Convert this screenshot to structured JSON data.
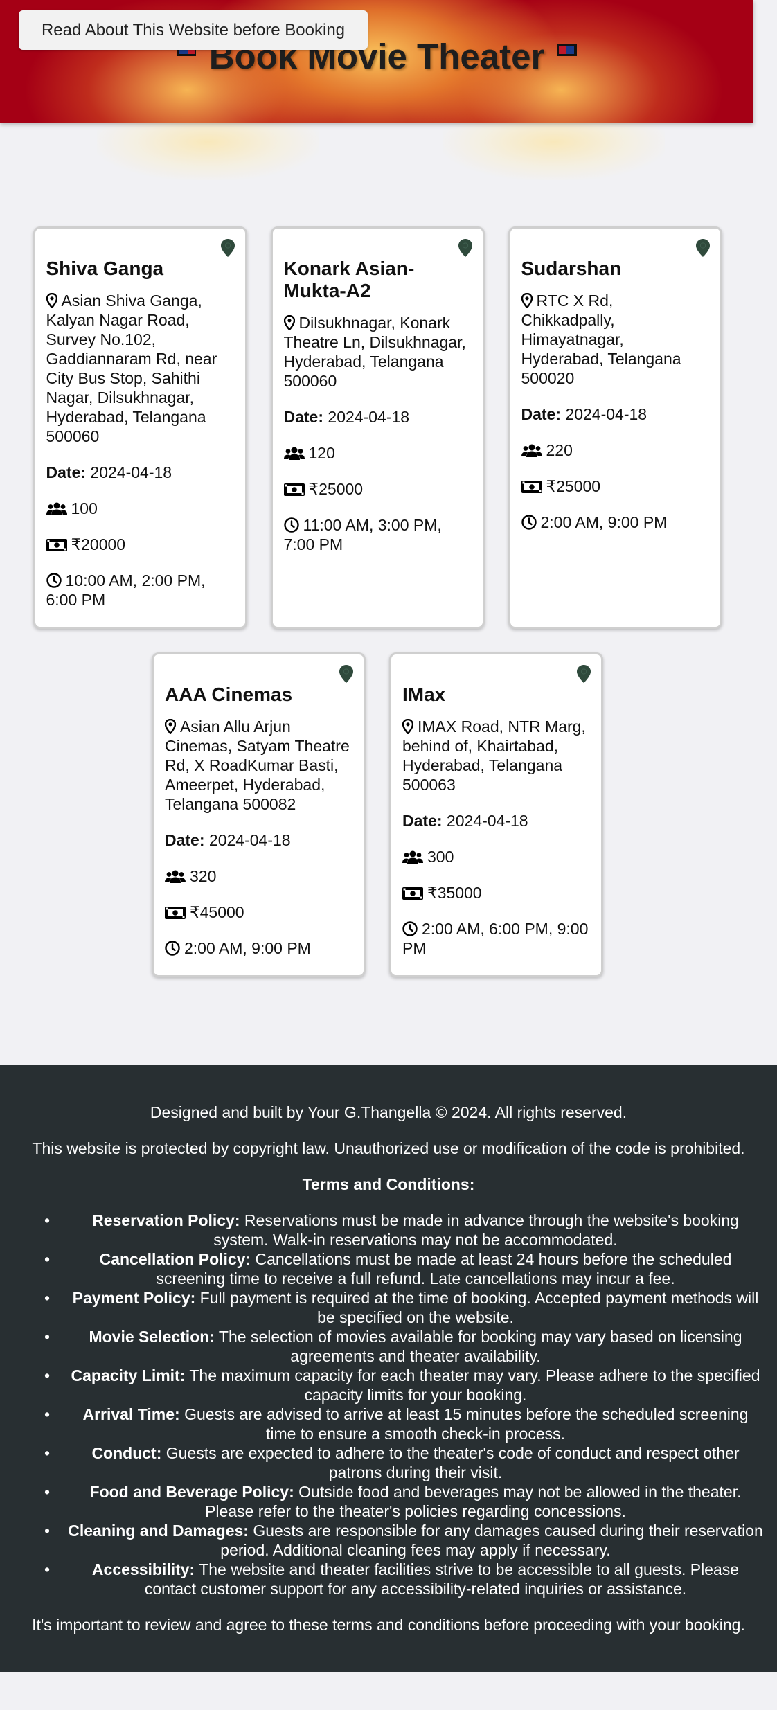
{
  "header": {
    "read_button_label": "Read About This Website before Booking",
    "title": "Book Movie Theater"
  },
  "theaters": [
    {
      "name": "Shiva Ganga",
      "address": "Asian Shiva Ganga, Kalyan Nagar Road, Survey No.102, Gaddiannaram Rd, near City Bus Stop, Sahithi Nagar, Dilsukhnagar, Hyderabad, Telangana 500060",
      "date_label": "Date:",
      "date": "2024-04-18",
      "capacity": "100",
      "price": "₹20000",
      "timings": "10:00 AM, 2:00 PM, 6:00 PM"
    },
    {
      "name": "Konark Asian-Mukta-A2",
      "address": "Dilsukhnagar, Konark Theatre Ln, Dilsukhnagar, Hyderabad, Telangana 500060",
      "date_label": "Date:",
      "date": "2024-04-18",
      "capacity": "120",
      "price": "₹25000",
      "timings": "11:00 AM, 3:00 PM, 7:00 PM"
    },
    {
      "name": "Sudarshan",
      "address": "RTC X Rd, Chikkadpally, Himayatnagar, Hyderabad, Telangana 500020",
      "date_label": "Date:",
      "date": "2024-04-18",
      "capacity": "220",
      "price": "₹25000",
      "timings": "2:00 AM, 9:00 PM"
    },
    {
      "name": "AAA Cinemas",
      "address": "Asian Allu Arjun Cinemas, Satyam Theatre Rd, X RoadKumar Basti, Ameerpet, Hyderabad, Telangana 500082",
      "date_label": "Date:",
      "date": "2024-04-18",
      "capacity": "320",
      "price": "₹45000",
      "timings": "2:00 AM, 9:00 PM"
    },
    {
      "name": "IMax",
      "address": "IMAX Road, NTR Marg, behind of, Khairtabad, Hyderabad, Telangana 500063",
      "date_label": "Date:",
      "date": "2024-04-18",
      "capacity": "300",
      "price": "₹35000",
      "timings": "2:00 AM, 6:00 PM, 9:00 PM"
    }
  ],
  "footer": {
    "credit": "Designed and built by Your G.Thangella © 2024. All rights reserved.",
    "copyright": "This website is protected by copyright law. Unauthorized use or modification of the code is prohibited.",
    "terms_title": "Terms and Conditions:",
    "terms": [
      {
        "title": "Reservation Policy:",
        "text": " Reservations must be made in advance through the website's booking system. Walk-in reservations may not be accommodated."
      },
      {
        "title": "Cancellation Policy:",
        "text": " Cancellations must be made at least 24 hours before the scheduled screening time to receive a full refund. Late cancellations may incur a fee."
      },
      {
        "title": "Payment Policy:",
        "text": " Full payment is required at the time of booking. Accepted payment methods will be specified on the website."
      },
      {
        "title": "Movie Selection:",
        "text": " The selection of movies available for booking may vary based on licensing agreements and theater availability."
      },
      {
        "title": "Capacity Limit:",
        "text": " The maximum capacity for each theater may vary. Please adhere to the specified capacity limits for your booking."
      },
      {
        "title": "Arrival Time:",
        "text": " Guests are advised to arrive at least 15 minutes before the scheduled screening time to ensure a smooth check-in process."
      },
      {
        "title": "Conduct:",
        "text": " Guests are expected to adhere to the theater's code of conduct and respect other patrons during their visit."
      },
      {
        "title": "Food and Beverage Policy:",
        "text": " Outside food and beverages may not be allowed in the theater. Please refer to the theater's policies regarding concessions."
      },
      {
        "title": "Cleaning and Damages:",
        "text": " Guests are responsible for any damages caused during their reservation period. Additional cleaning fees may apply if necessary."
      },
      {
        "title": "Accessibility:",
        "text": " The website and theater facilities strive to be accessible to all guests. Please contact customer support for any accessibility-related inquiries or assistance."
      }
    ],
    "closing": "It's important to review and agree to these terms and conditions before proceeding with your booking."
  },
  "colors": {
    "header_red": "#a50015",
    "footer_bg": "#282f32",
    "pin_green": "#2f4a3c"
  }
}
